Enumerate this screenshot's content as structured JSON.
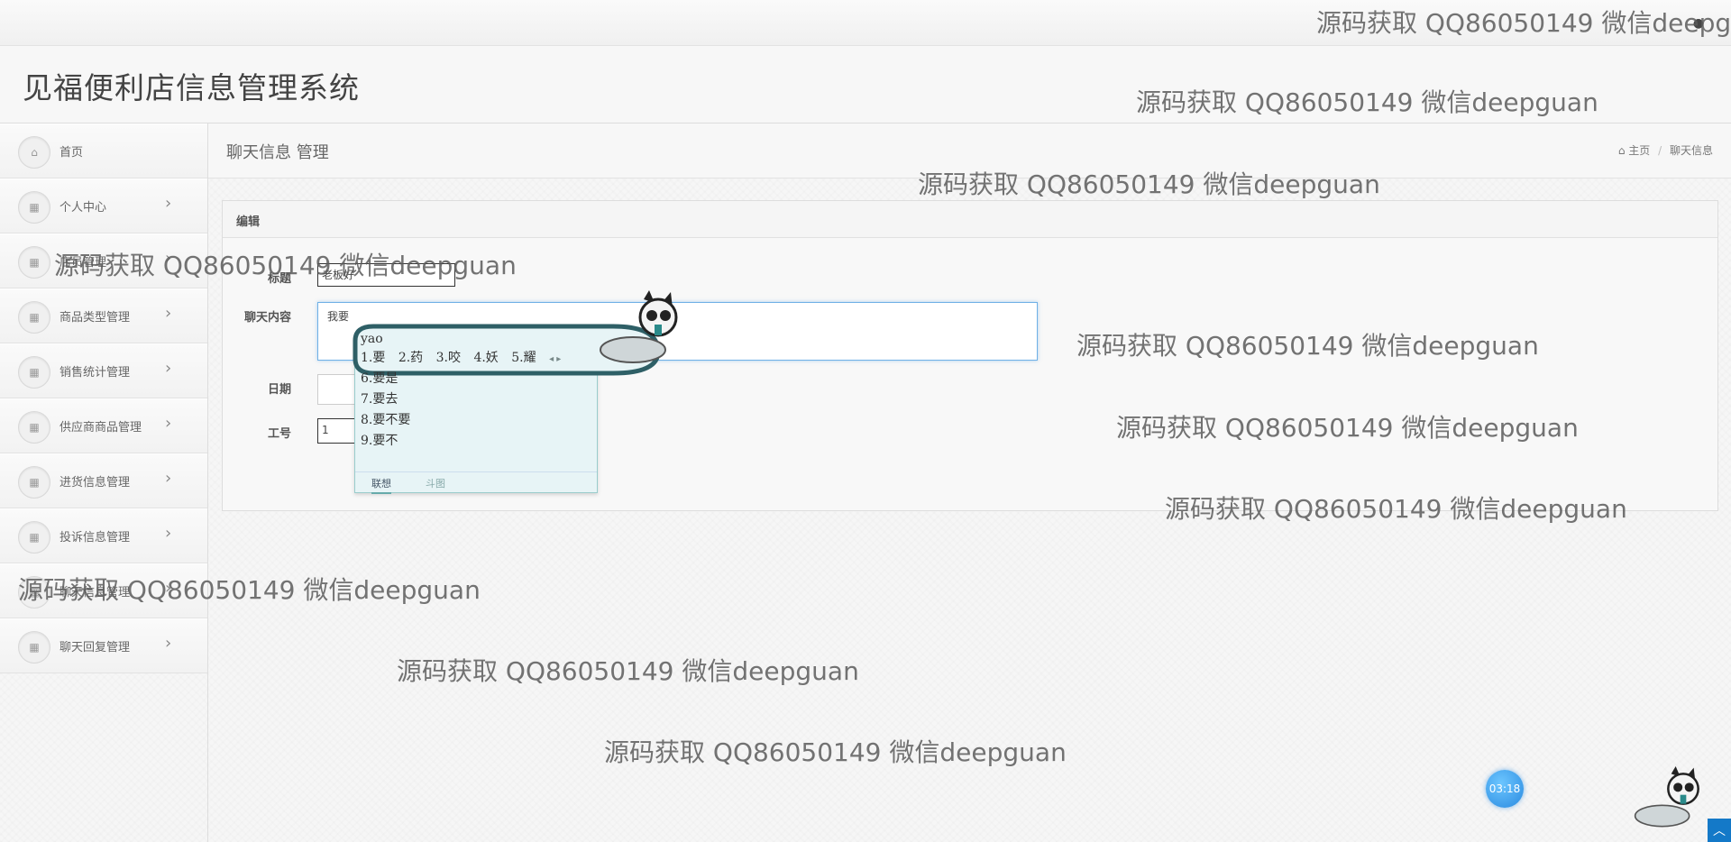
{
  "app": {
    "title": "见福便利店信息管理系统",
    "top_menu": "●"
  },
  "sidebar": {
    "items": [
      {
        "label": "首页",
        "icon": "home-icon",
        "glyph": "⌂",
        "has_chevron": false
      },
      {
        "label": "个人中心",
        "icon": "grid-icon",
        "glyph": "▦",
        "has_chevron": true
      },
      {
        "label": "店员管理",
        "icon": "grid-icon",
        "glyph": "▦",
        "has_chevron": true
      },
      {
        "label": "商品类型管理",
        "icon": "grid-icon",
        "glyph": "▦",
        "has_chevron": true
      },
      {
        "label": "销售统计管理",
        "icon": "grid-icon",
        "glyph": "▦",
        "has_chevron": true
      },
      {
        "label": "供应商商品管理",
        "icon": "grid-icon",
        "glyph": "▦",
        "has_chevron": true
      },
      {
        "label": "进货信息管理",
        "icon": "grid-icon",
        "glyph": "▦",
        "has_chevron": true
      },
      {
        "label": "投诉信息管理",
        "icon": "grid-icon",
        "glyph": "▦",
        "has_chevron": true
      },
      {
        "label": "聊天信息管理",
        "icon": "grid-icon",
        "glyph": "▦",
        "has_chevron": true
      },
      {
        "label": "聊天回复管理",
        "icon": "grid-icon",
        "glyph": "▦",
        "has_chevron": true
      }
    ],
    "chevron": "›"
  },
  "header": {
    "page_title": "聊天信息 管理",
    "breadcrumb_home": "主页",
    "breadcrumb_home_icon": "⌂",
    "breadcrumb_sep": "/",
    "breadcrumb_current": "聊天信息"
  },
  "form": {
    "panel_title": "编辑",
    "title_label": "标题",
    "title_value": "老板好",
    "content_label": "聊天内容",
    "content_value": "我要",
    "date_label": "日期",
    "date_value": "",
    "staff_label": "工号",
    "staff_value": "1"
  },
  "ime": {
    "pinyin": "yao",
    "candidates_row1": [
      "1.要",
      "2.药",
      "3.咬",
      "4.妖",
      "5.耀"
    ],
    "candidates_more": [
      "6.要是",
      "7.要去",
      "8.要不要",
      "9.要不"
    ],
    "tab_active": "联想",
    "tab_other": "斗图",
    "nav_glyphs": "◂ ▸"
  },
  "watermark": "源码获取 QQ86050149 微信deepguan",
  "timer": "03:18",
  "scrolltop_glyph": "︿",
  "colors": {
    "accent": "#1479c8",
    "ime_bg": "#e7f4f6",
    "ime_frame": "#2e5f66"
  }
}
